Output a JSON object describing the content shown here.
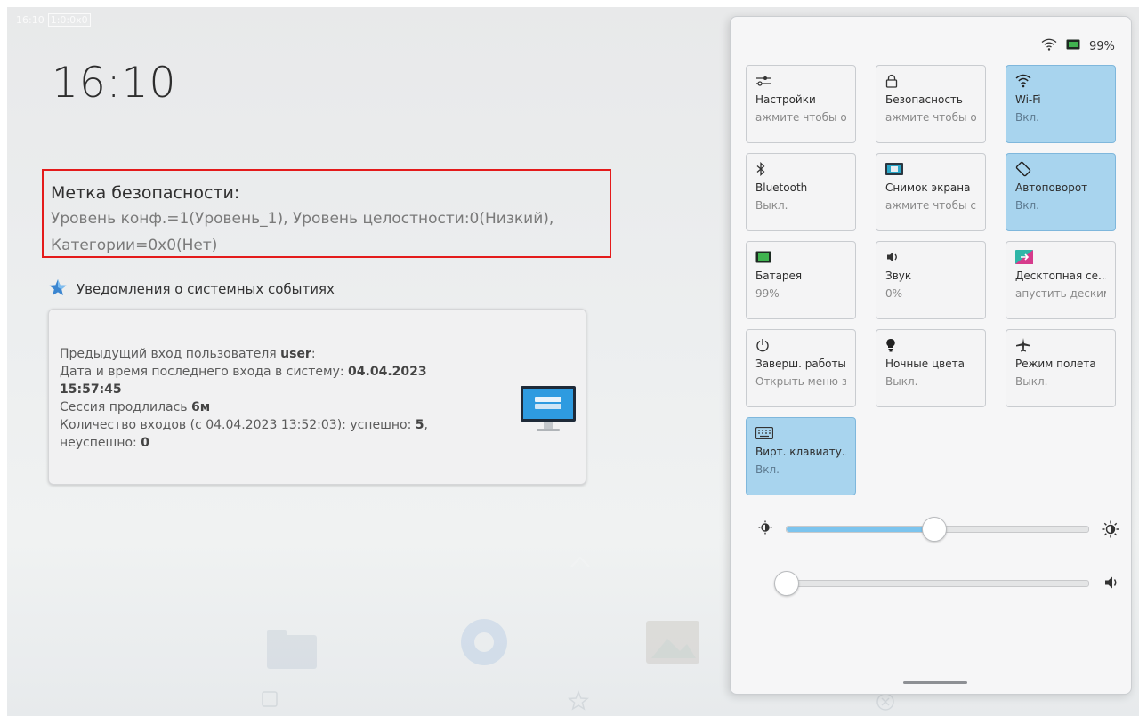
{
  "statusbar": {
    "time": "16:10",
    "label": "1:0:0x0"
  },
  "clock": {
    "time": "16:10"
  },
  "security_label": {
    "title": "Метка безопасности:",
    "line1": "Уровень конф.=1(Уровень_1), Уровень целостности:0(Низкий),",
    "line2": "Категории=0x0(Нет)"
  },
  "notifications": {
    "header": "Уведомления о системных событиях",
    "card": {
      "line1_prefix": "Предыдущий вход пользователя ",
      "user": "user",
      "line1_suffix": ":",
      "line2_prefix": "Дата и время последнего входа в систему: ",
      "last_date": "04.04.2023",
      "last_time": "15:57:45",
      "line3_prefix": "Сессия продлилась ",
      "duration": "6м",
      "line4_prefix": "Количество входов (с 04.04.2023 13:52:03): успешно: ",
      "success": "5",
      "line4_suffix": ",",
      "line5_prefix": "неуспешно: ",
      "failed": "0"
    }
  },
  "panel": {
    "status": {
      "battery": "99%"
    },
    "tiles": [
      {
        "name": "Настройки",
        "state": "ажмите чтобы о",
        "icon": "sliders-icon",
        "on": false
      },
      {
        "name": "Безопасность",
        "state": "ажмите чтобы о",
        "icon": "lock-icon",
        "on": false
      },
      {
        "name": "Wi-Fi",
        "state": "Вкл.",
        "icon": "wifi-icon",
        "on": true
      },
      {
        "name": "Bluetooth",
        "state": "Выкл.",
        "icon": "bluetooth-icon",
        "on": false
      },
      {
        "name": "Снимок экрана",
        "state": "ажмите чтобы с",
        "icon": "screenshot-icon",
        "on": false
      },
      {
        "name": "Автоповорот",
        "state": "Вкл.",
        "icon": "rotate-icon",
        "on": true
      },
      {
        "name": "Батарея",
        "state": "99%",
        "icon": "battery-icon",
        "on": false
      },
      {
        "name": "Звук",
        "state": "0%",
        "icon": "speaker-icon",
        "on": false
      },
      {
        "name": "Десктопная се...",
        "state": "апустить деским",
        "icon": "desktop-session-icon",
        "on": false
      },
      {
        "name": "Заверш. работы",
        "state": "Открыть меню з",
        "icon": "power-icon",
        "on": false
      },
      {
        "name": "Ночные цвета",
        "state": "Выкл.",
        "icon": "bulb-icon",
        "on": false
      },
      {
        "name": "Режим полета",
        "state": "Выкл.",
        "icon": "airplane-icon",
        "on": false
      },
      {
        "name": "Вирт. клавиату...",
        "state": "Вкл.",
        "icon": "keyboard-icon",
        "on": true
      }
    ],
    "brightness": {
      "value_fraction": 0.49
    },
    "volume": {
      "value_fraction": 0.0
    }
  }
}
